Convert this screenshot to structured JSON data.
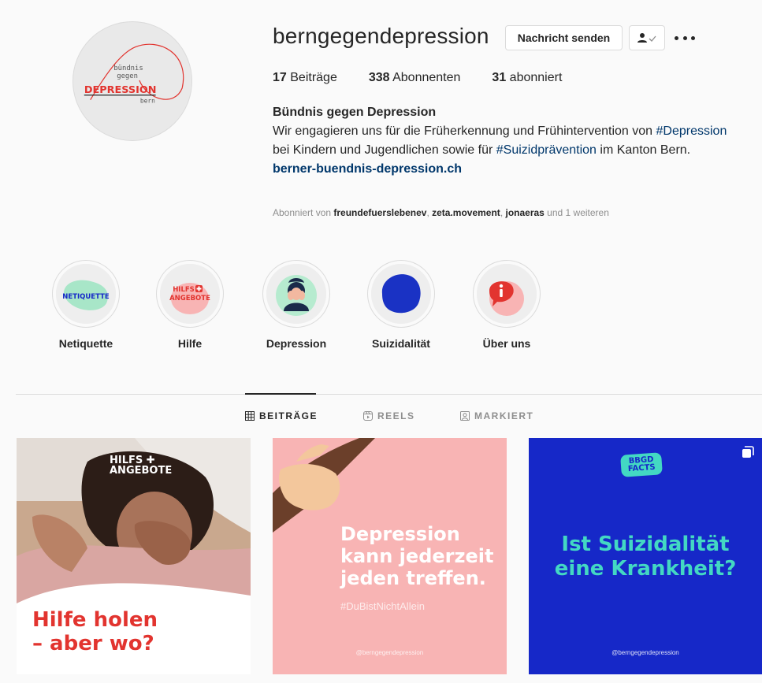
{
  "profile": {
    "username": "berngegendepression",
    "message_button": "Nachricht senden",
    "avatar_text": {
      "line1": "bündnis",
      "line2": "gegen",
      "line3": "DEPRESSION",
      "line4": "bern"
    }
  },
  "stats": {
    "posts_count": "17",
    "posts_label": "Beiträge",
    "followers_count": "338",
    "followers_label": "Abonnenten",
    "following_count": "31",
    "following_label": "abonniert"
  },
  "bio": {
    "name": "Bündnis gegen Depression",
    "text_part1": "Wir engagieren uns für die Früherkennung und Frühintervention von ",
    "hashtag1": "#Depression",
    "text_part2": " bei Kindern und Jugendlichen sowie für ",
    "hashtag2": "#Suizidprävention",
    "text_part3": " im Kanton Bern.",
    "link": "berner-buendnis-depression.ch"
  },
  "followed_by": {
    "prefix": "Abonniert von ",
    "user1": "freundefuerslebenev",
    "user2": "zeta.movement",
    "user3": "jonaeras",
    "suffix": " und 1 weiteren"
  },
  "highlights": [
    {
      "label": "Netiquette",
      "cover_text": "NETIQUETTE",
      "color": "#a8e6c8"
    },
    {
      "label": "Hilfe",
      "cover_text1": "HILFS",
      "cover_text2": "ANGEBOTE",
      "color": "#f8b4b4"
    },
    {
      "label": "Depression",
      "color": "#b6ebcf"
    },
    {
      "label": "Suizidalität",
      "color": "#1a32c4"
    },
    {
      "label": "Über uns",
      "color": "#e2342f"
    }
  ],
  "tabs": {
    "posts": "BEITRÄGE",
    "reels": "REELS",
    "tagged": "MARKIERT"
  },
  "posts": [
    {
      "badge_line1": "HILFS",
      "badge_line2": "ANGEBOTE",
      "caption_line1": "Hilfe holen",
      "caption_line2": "– aber wo?"
    },
    {
      "title_line1": "Depression",
      "title_line2": "kann jederzeit",
      "title_line3": "jeden treffen.",
      "hashtag": "#DuBistNichtAllein",
      "handle": "@berngegendepression"
    },
    {
      "badge_line1": "BBGD",
      "badge_line2": "FACTS",
      "title_line1": "Ist Suizidalität",
      "title_line2": "eine Krankheit?",
      "handle": "@berngegendepression"
    }
  ],
  "colors": {
    "accent_link": "#00376b",
    "brand_red": "#e2342f",
    "brand_blue": "#1628c8",
    "brand_mint": "#43d8c3"
  }
}
